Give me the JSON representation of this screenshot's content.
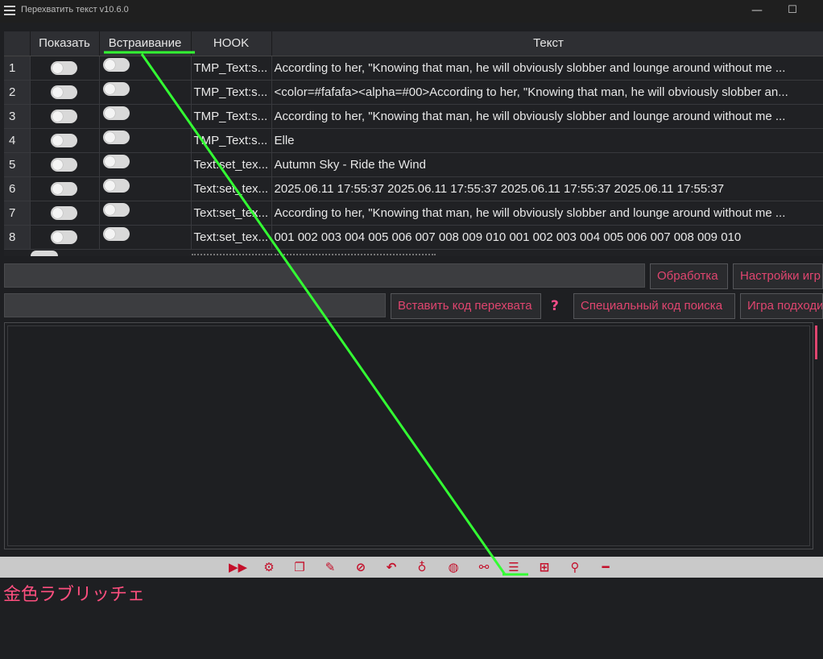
{
  "window": {
    "title": "Перехватить текст v10.6.0",
    "minimize_glyph": "—",
    "maximize_glyph": "☐"
  },
  "table": {
    "columns": [
      "Показать",
      "Встраивание",
      "HOOK",
      "Текст"
    ],
    "rows": [
      {
        "num": "1",
        "hook": "TMP_Text:s...",
        "text": "According to her, \"Knowing that man, he will obviously slobber and lounge around without me ..."
      },
      {
        "num": "2",
        "hook": "TMP_Text:s...",
        "text": "<color=#fafafa><alpha=#00>According to her, \"Knowing that man, he will obviously slobber an..."
      },
      {
        "num": "3",
        "hook": "TMP_Text:s...",
        "text": "According to her, \"Knowing that man, he will obviously slobber and lounge around without me ..."
      },
      {
        "num": "4",
        "hook": "TMP_Text:s...",
        "text": "Elle"
      },
      {
        "num": "5",
        "hook": "Text:set_tex...",
        "text": "Autumn Sky - Ride the Wind"
      },
      {
        "num": "6",
        "hook": "Text:set_tex...",
        "text": "2025.06.11  17:55:37 2025.06.11  17:55:37 2025.06.11  17:55:37 2025.06.11  17:55:37"
      },
      {
        "num": "7",
        "hook": "Text:set_tex...",
        "text": "According to her, \"Knowing that man, he will obviously slobber and lounge around without me ..."
      },
      {
        "num": "8",
        "hook": "Text:set_tex...",
        "text": "001 002 003 004 005 006 007 008 009 010 001 002 003 004 005 006 007 008 009 010"
      }
    ]
  },
  "controls": {
    "processing_button": "Обработка",
    "game_settings_button": "Настройки игр",
    "insert_hook_button": "Вставить код перехвата",
    "help_mark": "?",
    "special_search_button": "Специальный код поиска",
    "suitable_game_button": "Игра подходи",
    "hook_input_value": "",
    "filter_input_value": ""
  },
  "toolbar": {
    "icons": [
      "fast-forward-icon",
      "gear-icon",
      "copy-icon",
      "edit-icon",
      "hide-eye-icon",
      "undo-icon",
      "lightbulb-icon",
      "gamepad-icon",
      "link-icon",
      "text-hook-icon",
      "windows-icon",
      "pin-icon",
      "minus-icon"
    ]
  },
  "output": {
    "translated_text": "金色ラブリッチェ"
  },
  "colors": {
    "accent": "#e0456f",
    "toolbar_icon": "#c40f2a",
    "annotation": "#33ff33"
  }
}
